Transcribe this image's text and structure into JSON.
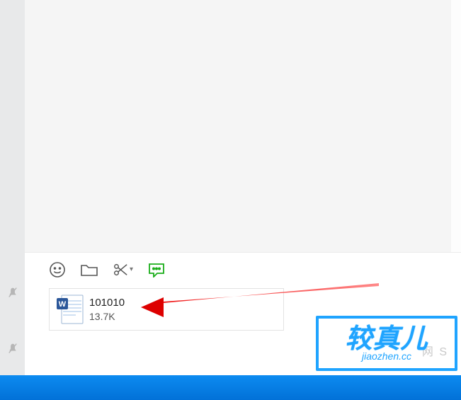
{
  "toolbar": {
    "emoji_name": "emoji-icon",
    "folder_name": "folder-icon",
    "scissors_name": "scissors-icon",
    "chat_name": "chat-history-icon"
  },
  "attachment": {
    "file_name": "101010",
    "file_size": "13.7K",
    "icon_name": "word-doc-icon"
  },
  "watermark": {
    "main": "较真儿",
    "sub": "jiaozhen.cc",
    "ghost": "网 S"
  }
}
